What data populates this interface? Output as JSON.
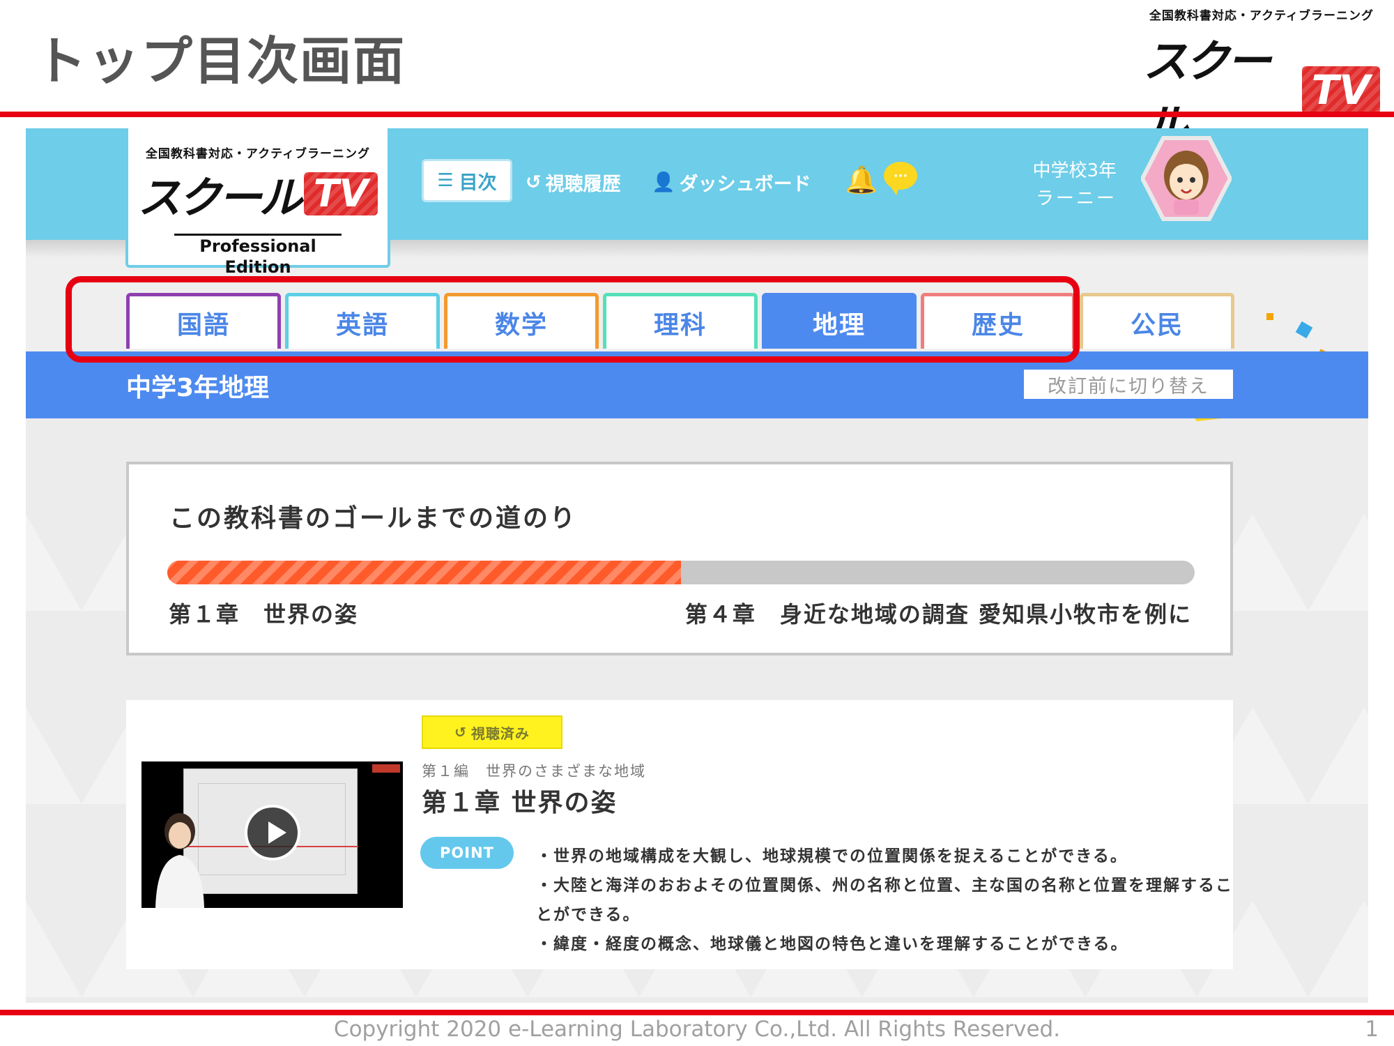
{
  "slide": {
    "title": "トップ目次画面",
    "copyright": "Copyright 2020 e-Learning Laboratory Co.,Ltd. All Rights Reserved.",
    "page_number": "1"
  },
  "brand": {
    "tagline": "全国教科書対応・アクティブラーニング",
    "name": "スクール",
    "tv": "TV",
    "edition": "Professional Edition"
  },
  "nav": {
    "toc": "目次",
    "history": "視聴履歴",
    "dashboard": "ダッシュボード"
  },
  "user": {
    "grade": "中学校3年",
    "name": "ラーニー"
  },
  "tabs": [
    {
      "label": "国語",
      "color": "#8e3fb0"
    },
    {
      "label": "英語",
      "color": "#5ccfe6"
    },
    {
      "label": "数学",
      "color": "#f39a2e"
    },
    {
      "label": "理科",
      "color": "#56e0b8"
    },
    {
      "label": "地理",
      "color": "#4d8af0",
      "active": true
    },
    {
      "label": "歴史",
      "color": "#f07d7d"
    },
    {
      "label": "公民",
      "color": "#e8c88c"
    }
  ],
  "subject": {
    "title": "中学3年地理",
    "switch_label": "改訂前に切り替え"
  },
  "goal": {
    "title": "この教科書のゴールまでの道のり",
    "progress_percent": 50,
    "start_label": "第１章　世界の姿",
    "end_label": "第４章　身近な地域の調査 愛知県小牧市を例に"
  },
  "lesson": {
    "status": "視聴済み",
    "section": "第１編　世界のさまざまな地域",
    "title": "第１章 世界の姿",
    "point_label": "POINT",
    "points": [
      "・世界の地域構成を大観し、地球規模での位置関係を捉えることができる。",
      "・大陸と海洋のおおよその位置関係、州の名称と位置、主な国の名称と位置を理解するこ",
      "とができる。",
      "・緯度・経度の概念、地球儀と地図の特色と違いを理解することができる。"
    ]
  },
  "colors": {
    "accent_red": "#e60012",
    "topbar": "#6ecde8",
    "subject_blue": "#4d8af0",
    "progress": "#ff5a2a",
    "watched": "#fff21f"
  }
}
